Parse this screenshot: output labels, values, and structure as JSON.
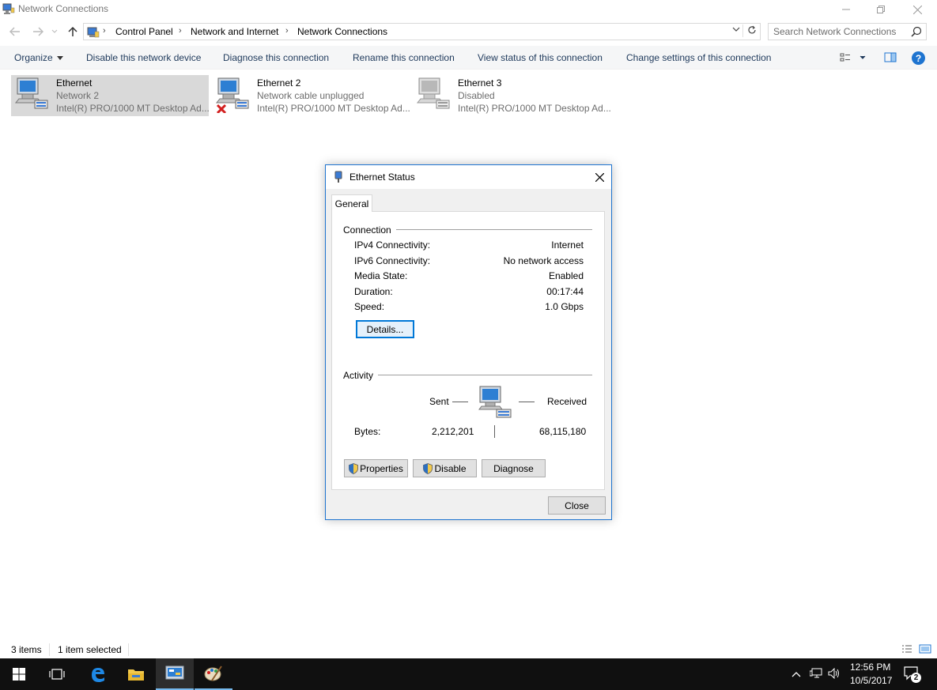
{
  "window": {
    "title": "Network Connections"
  },
  "breadcrumb": {
    "items": [
      "Control Panel",
      "Network and Internet",
      "Network Connections"
    ]
  },
  "search": {
    "placeholder": "Search Network Connections"
  },
  "commands": {
    "organize": "Organize",
    "disable": "Disable this network device",
    "diagnose": "Diagnose this connection",
    "rename": "Rename this connection",
    "view_status": "View status of this connection",
    "change_settings": "Change settings of this connection"
  },
  "connections": [
    {
      "name": "Ethernet",
      "status": "Network  2",
      "adapter": "Intel(R) PRO/1000 MT Desktop Ad...",
      "selected": true,
      "icon": "network-adapter-icon"
    },
    {
      "name": "Ethernet 2",
      "status": "Network cable unplugged",
      "adapter": "Intel(R) PRO/1000 MT Desktop Ad...",
      "selected": false,
      "icon": "network-adapter-unplugged-icon"
    },
    {
      "name": "Ethernet 3",
      "status": "Disabled",
      "adapter": "Intel(R) PRO/1000 MT Desktop Ad...",
      "selected": false,
      "icon": "network-adapter-disabled-icon"
    }
  ],
  "dialog": {
    "title": "Ethernet Status",
    "tab": "General",
    "connection_group": "Connection",
    "rows": [
      {
        "label": "IPv4 Connectivity:",
        "value": "Internet"
      },
      {
        "label": "IPv6 Connectivity:",
        "value": "No network access"
      },
      {
        "label": "Media State:",
        "value": "Enabled"
      },
      {
        "label": "Duration:",
        "value": "00:17:44"
      },
      {
        "label": "Speed:",
        "value": "1.0 Gbps"
      }
    ],
    "details_button": "Details...",
    "activity_group": "Activity",
    "sent_label": "Sent",
    "received_label": "Received",
    "bytes_label": "Bytes:",
    "bytes_sent": "2,212,201",
    "bytes_received": "68,115,180",
    "properties_button": "Properties",
    "disable_button": "Disable",
    "diagnose_button": "Diagnose",
    "close_button": "Close"
  },
  "status_bar": {
    "items_count": "3 items",
    "selected_count": "1 item selected"
  },
  "taskbar": {
    "time": "12:56 PM",
    "date": "10/5/2017",
    "notifications_count": "2"
  },
  "colors": {
    "accent": "#1e74d0",
    "selection": "#d9d9d9",
    "taskbar": "#101010"
  }
}
